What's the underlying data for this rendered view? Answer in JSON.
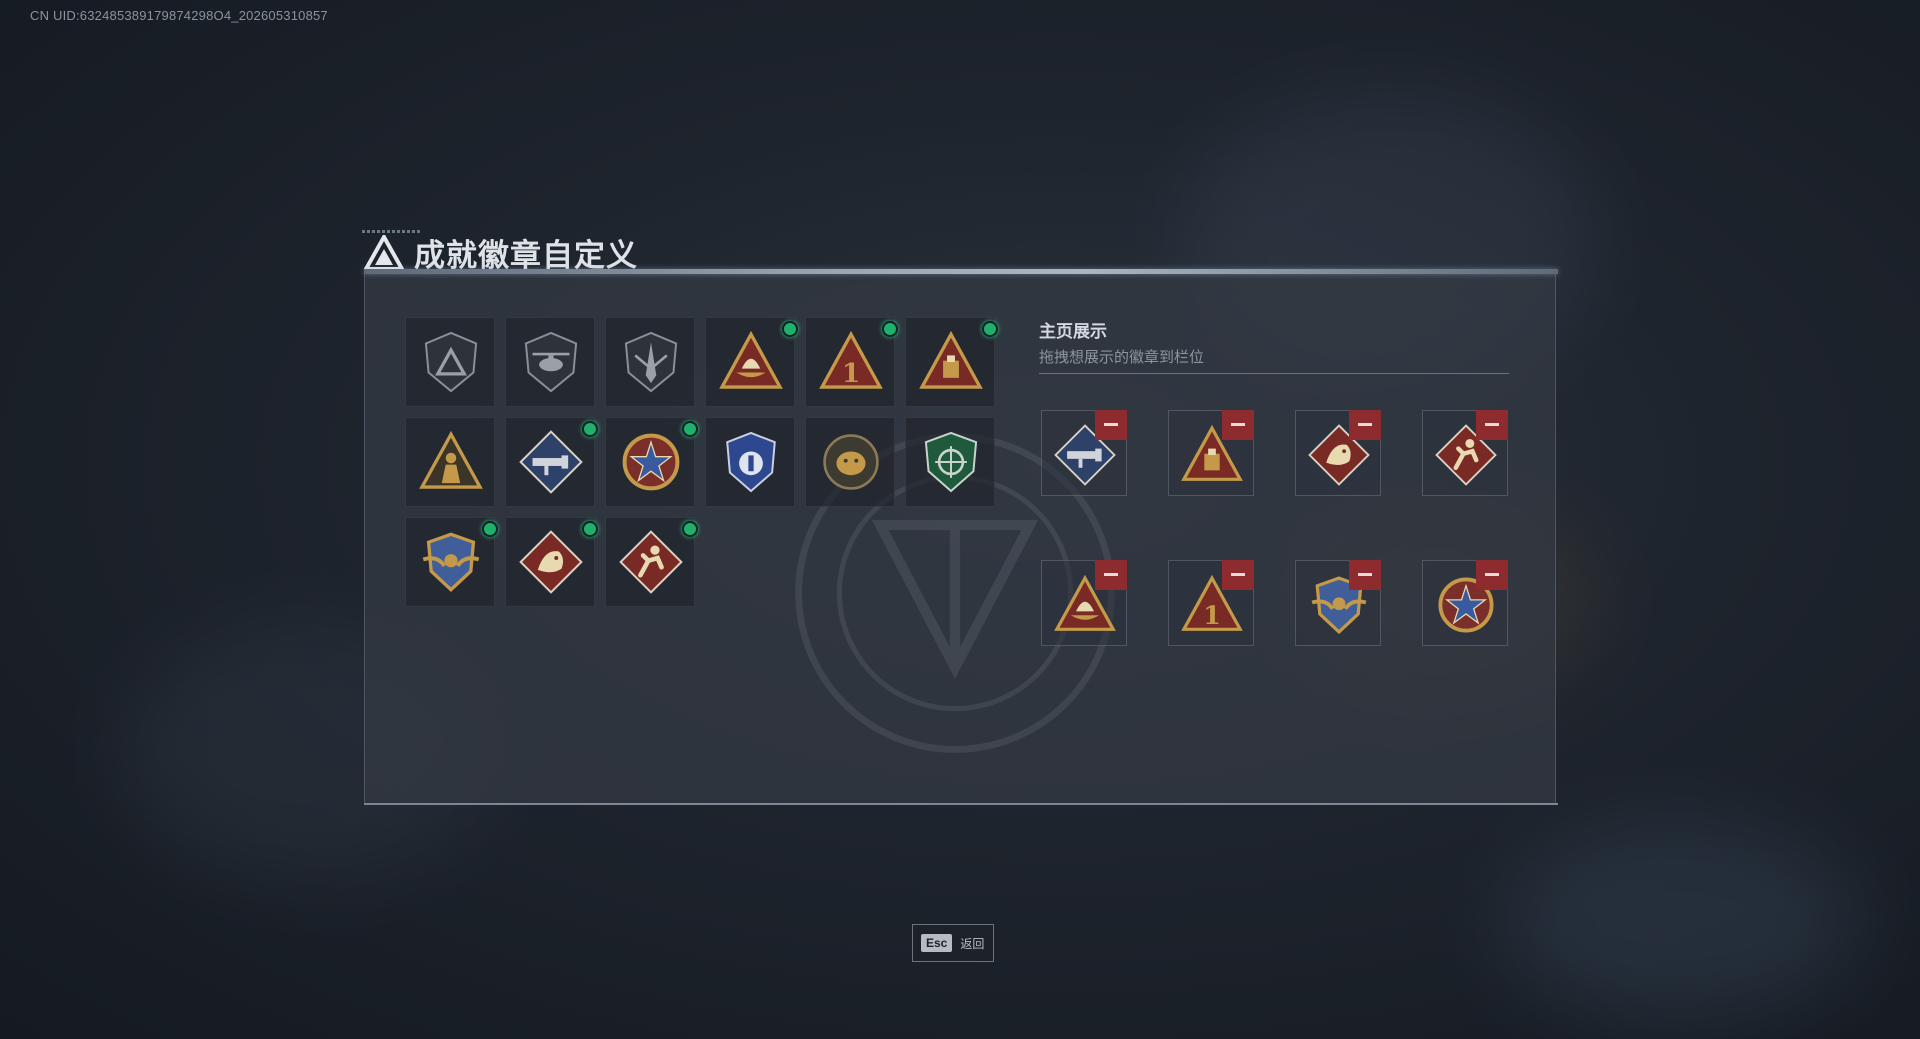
{
  "uid_text": "CN UID:632485389179874298O4_202605310857",
  "dialog": {
    "title": "成就徽章自定义"
  },
  "badge_grid": [
    {
      "icon": "triangle-emblem-badge-icon",
      "new": false
    },
    {
      "icon": "helicopter-badge-icon",
      "new": false
    },
    {
      "icon": "dagger-shield-badge-icon",
      "new": false
    },
    {
      "icon": "boat-triangle-badge-icon",
      "new": true
    },
    {
      "icon": "number-one-triangle-badge-icon",
      "new": true
    },
    {
      "icon": "crate-triangle-badge-icon",
      "new": true
    },
    {
      "icon": "soldier-triangle-badge-icon",
      "new": false
    },
    {
      "icon": "rocket-launcher-diamond-badge-icon",
      "new": true
    },
    {
      "icon": "star-medal-badge-icon",
      "new": true
    },
    {
      "icon": "police-shield-badge-icon",
      "new": false
    },
    {
      "icon": "gorilla-emblem-badge-icon",
      "new": false
    },
    {
      "icon": "green-crosshair-shield-badge-icon",
      "new": false
    },
    {
      "icon": "winged-shield-crest-badge-icon",
      "new": true
    },
    {
      "icon": "dragon-diamond-badge-icon",
      "new": true
    },
    {
      "icon": "runner-diamond-badge-icon",
      "new": true
    }
  ],
  "showcase": {
    "title": "主页展示",
    "subtitle": "拖拽想展示的徽章到栏位",
    "slots": [
      {
        "icon": "rocket-launcher-diamond-badge-icon"
      },
      {
        "icon": "crate-triangle-badge-icon"
      },
      {
        "icon": "dragon-diamond-badge-icon"
      },
      {
        "icon": "runner-diamond-badge-icon"
      },
      {
        "icon": "boat-triangle-badge-icon"
      },
      {
        "icon": "number-one-triangle-badge-icon"
      },
      {
        "icon": "winged-shield-crest-badge-icon"
      },
      {
        "icon": "star-medal-badge-icon"
      }
    ]
  },
  "footer": {
    "esc_key": "Esc",
    "esc_label": "返回"
  },
  "colors": {
    "new_dot": "#1fb06a",
    "remove": "#8e2b2f",
    "gold": "#c49a4a",
    "crimson": "#7a2a25"
  }
}
